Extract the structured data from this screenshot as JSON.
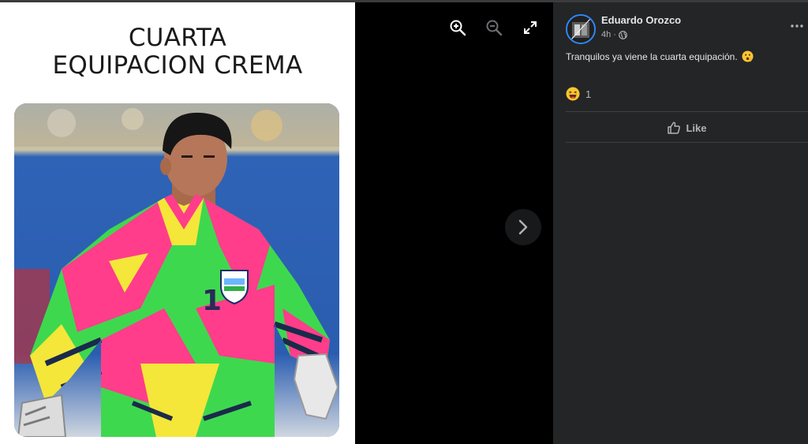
{
  "photo": {
    "title_line1": "CUARTA",
    "title_line2": "EQUIPACION CREMA",
    "jersey_number": "1"
  },
  "viewer": {
    "tools": [
      {
        "name": "zoom-in",
        "icon": "zoom-in-icon"
      },
      {
        "name": "zoom-out",
        "icon": "zoom-out-icon"
      },
      {
        "name": "fullscreen",
        "icon": "expand-icon"
      }
    ],
    "next_icon": "chevron-right-icon"
  },
  "post": {
    "author": "Eduardo Orozco",
    "time": "4h",
    "separator": "·",
    "audience_icon": "globe-icon",
    "text": "Tranquilos ya viene la cuarta equipación.",
    "text_emoji_icon": "shushing-face-icon",
    "reaction_icon": "haha-reaction-icon",
    "reaction_count": "1",
    "like_label": "Like",
    "more_icon": "more-options-icon"
  },
  "colors": {
    "panel_bg": "#242526",
    "text_primary": "#e4e6eb",
    "text_secondary": "#b0b3b8",
    "accent": "#2d88ff"
  }
}
